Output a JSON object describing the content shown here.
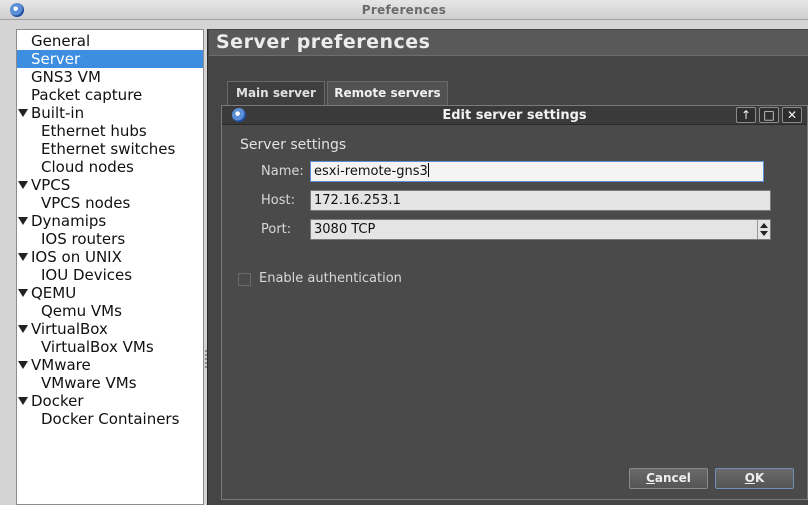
{
  "window": {
    "title": "Preferences"
  },
  "tree": [
    {
      "label": "General",
      "level": 0,
      "expandable": false,
      "selected": false
    },
    {
      "label": "Server",
      "level": 0,
      "expandable": false,
      "selected": true
    },
    {
      "label": "GNS3 VM",
      "level": 0,
      "expandable": false,
      "selected": false
    },
    {
      "label": "Packet capture",
      "level": 0,
      "expandable": false,
      "selected": false
    },
    {
      "label": "Built-in",
      "level": 0,
      "expandable": true,
      "selected": false
    },
    {
      "label": "Ethernet hubs",
      "level": 1,
      "expandable": false,
      "selected": false
    },
    {
      "label": "Ethernet switches",
      "level": 1,
      "expandable": false,
      "selected": false
    },
    {
      "label": "Cloud nodes",
      "level": 1,
      "expandable": false,
      "selected": false
    },
    {
      "label": "VPCS",
      "level": 0,
      "expandable": true,
      "selected": false
    },
    {
      "label": "VPCS nodes",
      "level": 1,
      "expandable": false,
      "selected": false
    },
    {
      "label": "Dynamips",
      "level": 0,
      "expandable": true,
      "selected": false
    },
    {
      "label": "IOS routers",
      "level": 1,
      "expandable": false,
      "selected": false
    },
    {
      "label": "IOS on UNIX",
      "level": 0,
      "expandable": true,
      "selected": false
    },
    {
      "label": "IOU Devices",
      "level": 1,
      "expandable": false,
      "selected": false
    },
    {
      "label": "QEMU",
      "level": 0,
      "expandable": true,
      "selected": false
    },
    {
      "label": "Qemu VMs",
      "level": 1,
      "expandable": false,
      "selected": false
    },
    {
      "label": "VirtualBox",
      "level": 0,
      "expandable": true,
      "selected": false
    },
    {
      "label": "VirtualBox VMs",
      "level": 1,
      "expandable": false,
      "selected": false
    },
    {
      "label": "VMware",
      "level": 0,
      "expandable": true,
      "selected": false
    },
    {
      "label": "VMware VMs",
      "level": 1,
      "expandable": false,
      "selected": false
    },
    {
      "label": "Docker",
      "level": 0,
      "expandable": true,
      "selected": false
    },
    {
      "label": "Docker Containers",
      "level": 1,
      "expandable": false,
      "selected": false
    }
  ],
  "page": {
    "title": "Server preferences",
    "tabs": [
      {
        "label": "Main server",
        "active": false
      },
      {
        "label": "Remote servers",
        "active": true
      }
    ]
  },
  "dialog": {
    "title": "Edit server settings",
    "buttons": {
      "up": "↑",
      "maximize": "□",
      "close": "✕"
    },
    "section_title": "Server settings",
    "name_label": "Name:",
    "name_value": "esxi-remote-gns3",
    "host_label": "Host:",
    "host_value": "172.16.253.1",
    "port_label": "Port:",
    "port_value": "3080 TCP",
    "enable_auth_label": "Enable authentication",
    "enable_auth_checked": false,
    "cancel_first": "C",
    "cancel_rest": "ancel",
    "ok_first": "O",
    "ok_rest": "K"
  },
  "colors": {
    "selection": "#3d8ee0",
    "pane_bg": "#454545",
    "dialog_bg": "#4a4a4a"
  },
  "icons": [
    "gns3-app-icon",
    "chevron-down-icon",
    "up-arrow-icon",
    "maximize-icon",
    "close-icon",
    "spin-up-icon",
    "spin-down-icon"
  ]
}
